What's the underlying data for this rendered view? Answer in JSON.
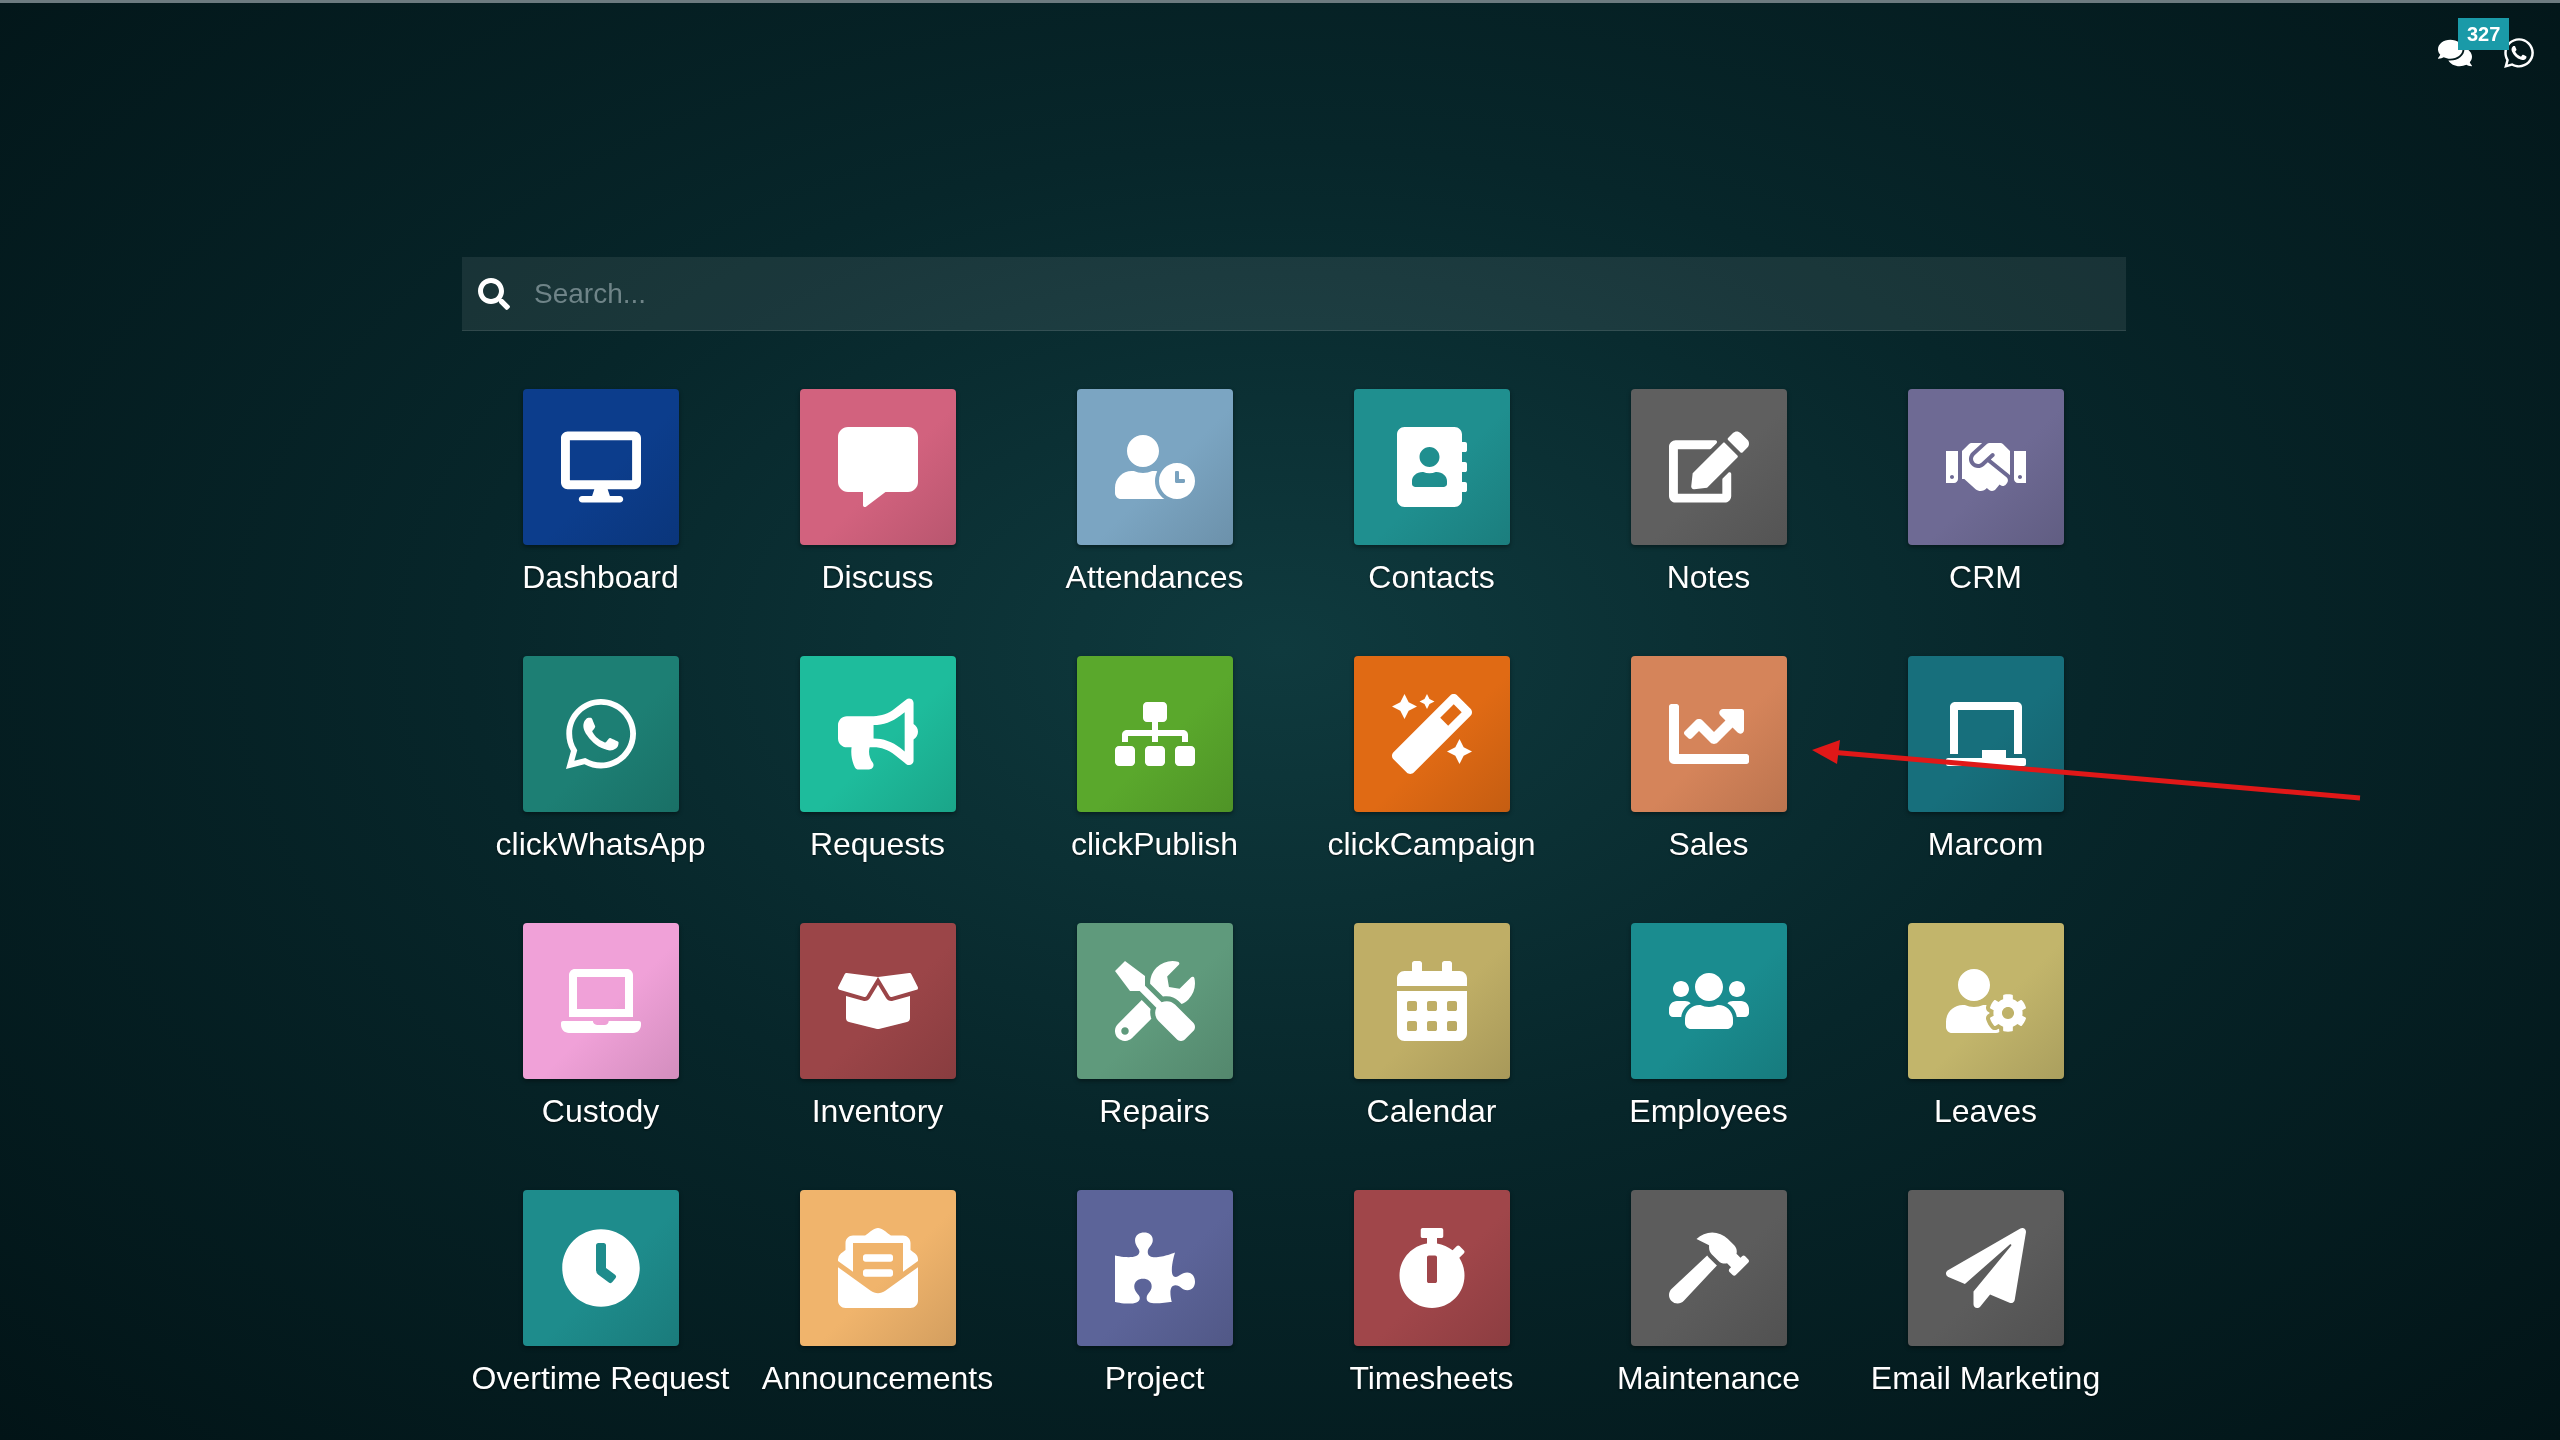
{
  "topbar": {
    "message_count": "327"
  },
  "search": {
    "placeholder": "Search..."
  },
  "apps": [
    {
      "label": "Dashboard",
      "color": "#0c3d8c"
    },
    {
      "label": "Discuss",
      "color": "#d2627e"
    },
    {
      "label": "Attendances",
      "color": "#7ba5c2"
    },
    {
      "label": "Contacts",
      "color": "#1f8f8f"
    },
    {
      "label": "Notes",
      "color": "#5f5f5f"
    },
    {
      "label": "CRM",
      "color": "#6e6a94"
    },
    {
      "label": "clickWhatsApp",
      "color": "#1d7f74"
    },
    {
      "label": "Requests",
      "color": "#1ebc9c"
    },
    {
      "label": "clickPublish",
      "color": "#5aa82c"
    },
    {
      "label": "clickCampaign",
      "color": "#e06a14"
    },
    {
      "label": "Sales",
      "color": "#d5845a"
    },
    {
      "label": "Marcom",
      "color": "#176f7c"
    },
    {
      "label": "Custody",
      "color": "#f0a1d8"
    },
    {
      "label": "Inventory",
      "color": "#9b4548"
    },
    {
      "label": "Repairs",
      "color": "#5f9a7c"
    },
    {
      "label": "Calendar",
      "color": "#bfae66"
    },
    {
      "label": "Employees",
      "color": "#1a8c8f"
    },
    {
      "label": "Leaves",
      "color": "#c2b56b"
    },
    {
      "label": "Overtime Request",
      "color": "#1e8c8c"
    },
    {
      "label": "Announcements",
      "color": "#f0b46c"
    },
    {
      "label": "Project",
      "color": "#5c6499"
    },
    {
      "label": "Timesheets",
      "color": "#a0464a"
    },
    {
      "label": "Maintenance",
      "color": "#5c5c5c"
    },
    {
      "label": "Email Marketing",
      "color": "#5c5c5c"
    }
  ]
}
